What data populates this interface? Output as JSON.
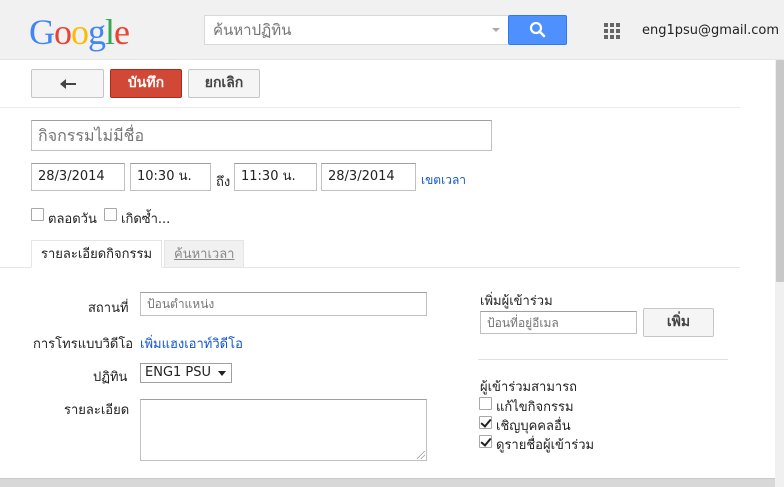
{
  "header": {
    "logo_letters": [
      {
        "char": "G",
        "color": "#4285f4"
      },
      {
        "char": "o",
        "color": "#ea4335"
      },
      {
        "char": "o",
        "color": "#fbbc05"
      },
      {
        "char": "g",
        "color": "#4285f4"
      },
      {
        "char": "l",
        "color": "#34a853"
      },
      {
        "char": "e",
        "color": "#ea4335"
      }
    ],
    "search_placeholder": "ค้นหาปฏิทิน",
    "search_icon": "search-icon",
    "apps_icon": "apps-grid-icon",
    "account_email": "eng1psu@gmail.com"
  },
  "toolbar": {
    "back_icon": "back-arrow-icon",
    "save_label": "บันทึก",
    "cancel_label": "ยกเลิก"
  },
  "event": {
    "title_placeholder": "กิจกรรมไม่มีชื่อ",
    "start_date": "28/3/2014",
    "start_time": "10:30 น.",
    "to_label": "ถึง",
    "end_time": "11:30 น.",
    "end_date": "28/3/2014",
    "timezone_link": "เขตเวลา",
    "all_day_label": "ตลอดวัน",
    "all_day_checked": false,
    "repeat_label": "เกิดซ้ำ...",
    "repeat_checked": false
  },
  "tabs": [
    {
      "label": "รายละเอียดกิจกรรม",
      "active": true
    },
    {
      "label": "ค้นหาเวลา",
      "active": false
    }
  ],
  "details": {
    "location_label": "สถานที่",
    "location_placeholder": "ป้อนตำแหน่ง",
    "video_call_label": "การโทรแบบวิดีโอ",
    "video_call_link": "เพิ่มแฮงเอาท์วิดีโอ",
    "calendar_label": "ปฏิทิน",
    "calendar_value": "ENG1 PSU",
    "description_label": "รายละเอียด"
  },
  "guests": {
    "add_label": "เพิ่มผู้เข้าร่วม",
    "email_placeholder": "ป้อนที่อยู่อีเมล",
    "add_button": "เพิ่ม",
    "permissions_label": "ผู้เข้าร่วมสามารถ",
    "permissions": [
      {
        "label": "แก้ไขกิจกรรม",
        "checked": false
      },
      {
        "label": "เชิญบุคคลอื่น",
        "checked": true
      },
      {
        "label": "ดูรายชื่อผู้เข้าร่วม",
        "checked": true
      }
    ]
  }
}
